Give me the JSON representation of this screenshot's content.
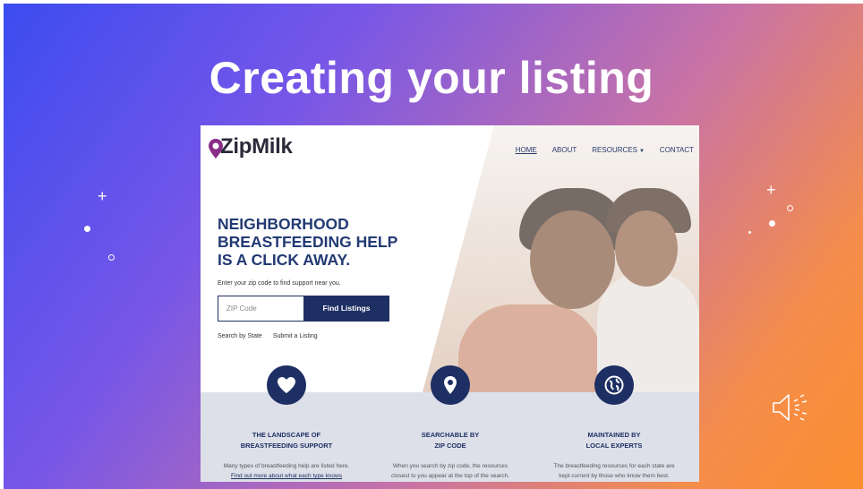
{
  "slide": {
    "title": "Creating your listing"
  },
  "site": {
    "logo": "ZipMilk",
    "nav": [
      {
        "label": "HOME",
        "active": true
      },
      {
        "label": "ABOUT",
        "active": false
      },
      {
        "label": "RESOURCES",
        "active": false,
        "dropdown": true
      },
      {
        "label": "CONTACT",
        "active": false
      }
    ],
    "hero": {
      "line1": "NEIGHBORHOOD",
      "line2": "BREASTFEEDING HELP",
      "line3": "IS A CLICK AWAY.",
      "subtitle": "Enter your zip code to find support near you.",
      "zip_placeholder": "ZIP Code",
      "button": "Find Listings",
      "link_state": "Search by State",
      "link_submit": "Submit a Listing"
    },
    "features": [
      {
        "icon": "heart-icon",
        "title1": "THE LANDSCAPE OF",
        "title2": "BREASTFEEDING SUPPORT",
        "desc": "Many types of breastfeeding help are listed here.",
        "link": "Find out more about what each type knows"
      },
      {
        "icon": "location-pin-icon",
        "title1": "SEARCHABLE BY",
        "title2": "ZIP CODE",
        "desc1": "When you search by zip code, the resources",
        "desc2": "closest to you appear at the top of the search."
      },
      {
        "icon": "globe-icon",
        "title1": "MAINTAINED BY",
        "title2": "LOCAL EXPERTS",
        "desc1": "The breastfeeding resources for each state are",
        "desc2": "kept current by those who know them best."
      }
    ],
    "colors": {
      "navy": "#1e2f63",
      "brand_purple": "#8a2d87"
    }
  }
}
